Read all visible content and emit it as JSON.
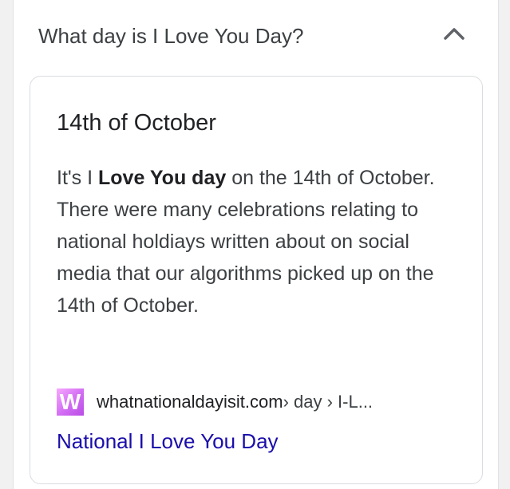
{
  "question": {
    "text": "What day is I Love You Day?",
    "icon": "chevron-up-icon",
    "expanded": true
  },
  "answer": {
    "title": "14th of October",
    "body": {
      "prefix": "It's I ",
      "bold": "Love You day",
      "suffix": " on the 14th of October. There were many celebrations relating to national holdiays written about on social media that our algorithms picked up on the 14th of October."
    },
    "source": {
      "favicon_letter": "W",
      "site": "whatnationaldayisit.com",
      "path": " › day › I-L..."
    },
    "link_text": "National I Love You Day"
  },
  "colors": {
    "link": "#1a0dab",
    "text": "#3c4043",
    "favicon": "#d16cf3"
  }
}
